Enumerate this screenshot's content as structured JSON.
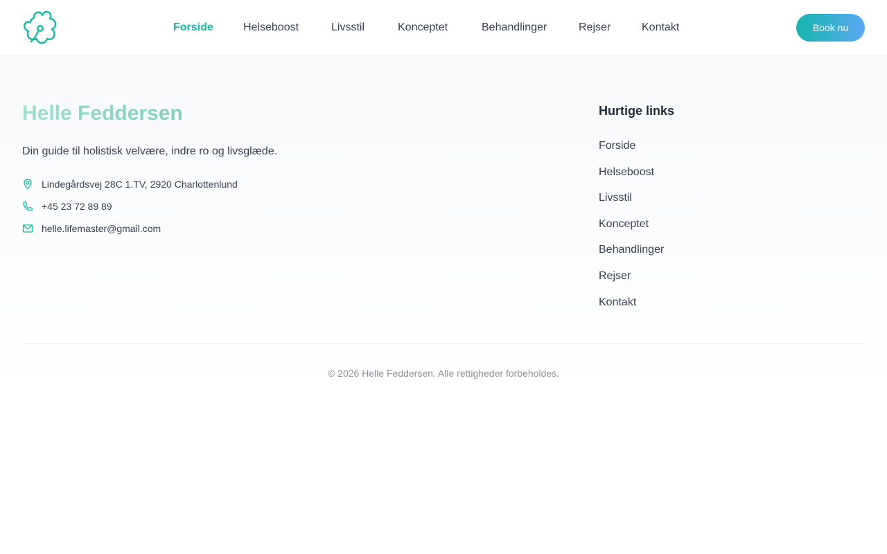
{
  "brand": {
    "logo_icon": "flower-icon",
    "accent_color": "#14b8a6"
  },
  "nav": {
    "items": [
      {
        "label": "Forside",
        "active": true
      },
      {
        "label": "Helseboost"
      },
      {
        "label": "Livsstil"
      },
      {
        "label": "Konceptet"
      },
      {
        "label": "Behandlinger"
      },
      {
        "label": "Rejser"
      },
      {
        "label": "Kontakt"
      }
    ],
    "book_label": "Book nu"
  },
  "footer": {
    "title": "Helle Feddersen",
    "tagline": "Din guide til holistisk velvære, indre ro og livsglæde.",
    "contact": {
      "address": "Lindegårdsvej 28C 1.TV, 2920 Charlottenlund",
      "phone": "+45 23 72 89 89",
      "email": "helle.lifemaster@gmail.com"
    },
    "links_title": "Hurtige links",
    "links": [
      "Forside",
      "Helseboost",
      "Livsstil",
      "Konceptet",
      "Behandlinger",
      "Rejser",
      "Kontakt"
    ],
    "copyright": "© 2026 Helle Feddersen. Alle rettigheder forbeholdes."
  }
}
